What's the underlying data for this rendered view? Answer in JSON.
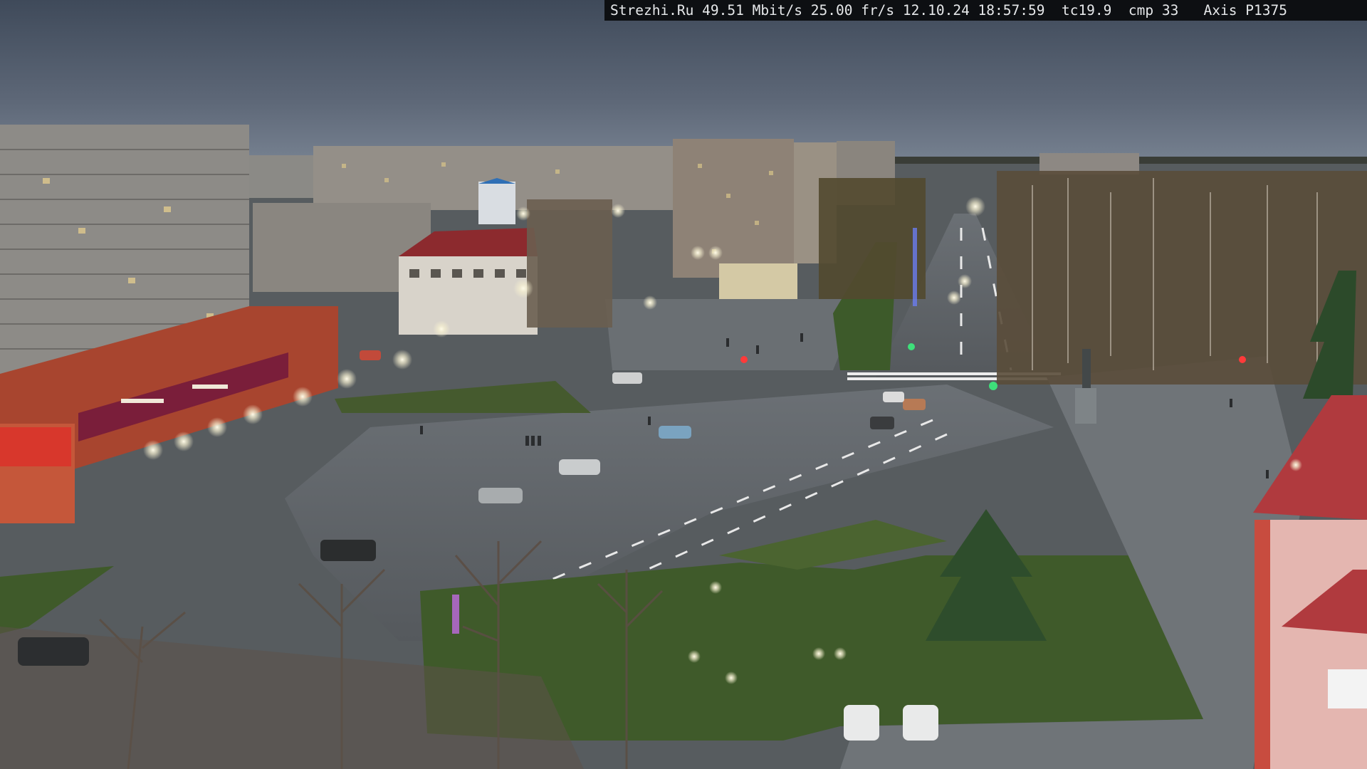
{
  "camera_overlay": {
    "text": "Strezhi.Ru 49.51 Mbit/s 25.00 fr/s 12.10.24 18:57:59  tc19.9  cmp 33   Axis P1375"
  },
  "colors": {
    "sky_top": "#3f4a5a",
    "sky_horizon": "#7a8594",
    "asphalt": "#5e6367",
    "grass": "#3f5a2a",
    "brick_red": "#a8452f",
    "store_sign": "#7a1e3a",
    "lamp_glow": "#f5efd0"
  },
  "icons": {
    "street_lamp": "lamp-icon",
    "traffic_light": "traffic-light-icon",
    "car": "car-icon"
  }
}
